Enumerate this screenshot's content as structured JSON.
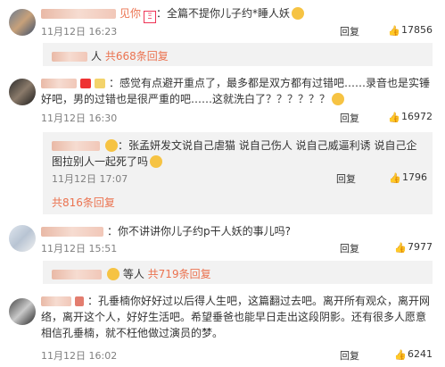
{
  "c1": {
    "name_suffix": "见你",
    "badge": "Ξ",
    "text": "全篇不提你儿子约*睡人妖",
    "time": "11月12日 16:23",
    "reply": "回复",
    "likes": "17856",
    "sub_name": "人",
    "sub_more": "共668条回复"
  },
  "c2": {
    "text": "感觉有点避开重点了，最多都是双方都有过错吧……录音也是实锤好吧，男的过错也是很严重的吧……这就洗白了？？？？？？",
    "time": "11月12日 16:30",
    "reply": "回复",
    "likes": "16972",
    "sub_text": "张孟妍发文说自己虐猫 说自己伤人 说自己威逼利诱 说自己企图拉别人一起死了吗",
    "sub_time": "11月12日 17:07",
    "sub_reply": "回复",
    "sub_likes": "1796",
    "more": "共816条回复"
  },
  "c3": {
    "text": "你不讲讲你儿子约p干人妖的事儿吗?",
    "time": "11月12日 15:51",
    "reply": "回复",
    "likes": "7977",
    "sub_name": "等人",
    "sub_more": "共719条回复"
  },
  "c4": {
    "text": "孔垂楠你好好过以后得人生吧，这篇翻过去吧。离开所有观众，离开网络，离开这个人，好好生活吧。希望垂爸也能早日走出这段阴影。还有很多人愿意相信孔垂楠，就不枉他做过演员的梦。",
    "time": "11月12日 16:02",
    "reply": "回复",
    "likes": "6241"
  }
}
